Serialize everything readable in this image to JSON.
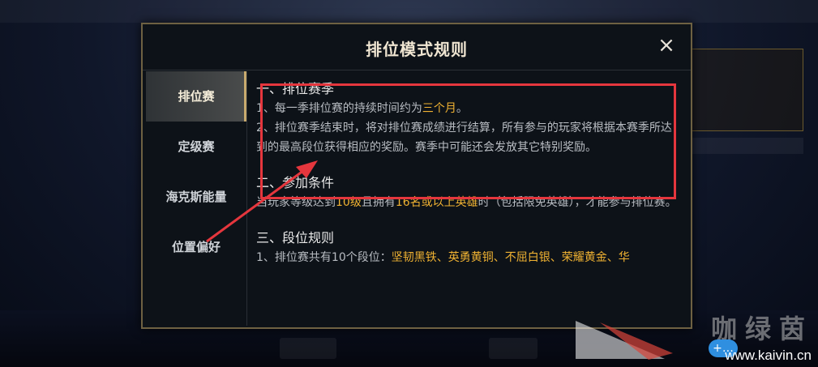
{
  "dialog": {
    "title": "排位模式规则",
    "close_symbol": "×"
  },
  "sidebar": {
    "items": [
      {
        "label": "排位赛",
        "active": true
      },
      {
        "label": "定级赛",
        "active": false
      },
      {
        "label": "海克斯能量",
        "active": false
      },
      {
        "label": "位置偏好",
        "active": false
      }
    ]
  },
  "content": {
    "s1_title": "一、排位赛季",
    "s1_p1_prefix": "1、每一季排位赛的持续时间约为",
    "s1_p1_highlight": "三个月",
    "s1_p1_suffix": "。",
    "s1_p2": "2、排位赛季结束时，将对排位赛成绩进行结算，所有参与的玩家将根据本赛季所达到的最高段位获得相应的奖励。赛季中可能还会发放其它特别奖励。",
    "s2_title": "二、参加条件",
    "s2_p_a": "当玩家等级达到",
    "s2_p_hl1": "10级",
    "s2_p_b": "且拥有",
    "s2_p_hl2": "16名或以上英雄",
    "s2_p_c": "时（包括限免英雄），才能参与排位赛。",
    "s3_title": "三、段位规则",
    "s3_p_a": "1、排位赛共有10个段位：",
    "s3_p_hl": "坚韧黑铁、英勇黄铜、不屈白银、荣耀黄金、华",
    "s3_p_b": ""
  },
  "annotation": {
    "box_color": "#e5363d"
  },
  "watermark": {
    "text": "咖绿茵",
    "url": "www.kaivin.cn",
    "bubble": "+…"
  },
  "colors": {
    "gold_highlight": "#f0b232",
    "frame_gold": "#6e6142"
  }
}
